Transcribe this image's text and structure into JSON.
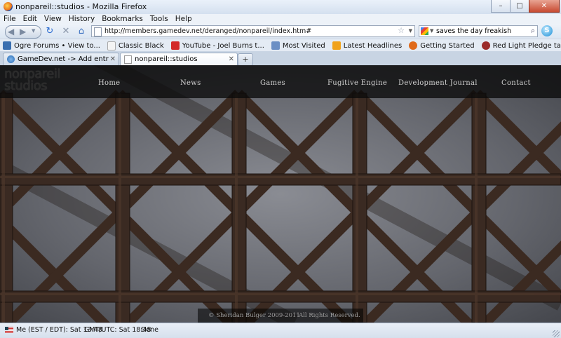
{
  "window": {
    "title": "nonpareil::studios - Mozilla Firefox"
  },
  "menu": [
    "File",
    "Edit",
    "View",
    "History",
    "Bookmarks",
    "Tools",
    "Help"
  ],
  "navigation": {
    "url": "http://members.gamedev.net/deranged/nonpareil/index.htm#",
    "search_value": "saves the day freakish"
  },
  "bookmarks": [
    {
      "label": "Ogre Forums • View to...",
      "color": "#3a6fb0"
    },
    {
      "label": "Classic Black",
      "color": "#d8d8d8"
    },
    {
      "label": "YouTube - Joel Burns t...",
      "color": "#d32a2a"
    },
    {
      "label": "Most Visited",
      "color": "#6b8fc4"
    },
    {
      "label": "Latest Headlines",
      "color": "#f0a21c"
    },
    {
      "label": "Getting Started",
      "color": "#e06a1a"
    },
    {
      "label": "Red Light Pledge tab b...",
      "color": "#9b2b2b"
    }
  ],
  "tabs": [
    {
      "label": "GameDev.net -> Add entry The Fug...",
      "active": false
    },
    {
      "label": "nonpareil::studios",
      "active": true
    }
  ],
  "site": {
    "logo_line1": "nonpareil",
    "logo_line2": "studios",
    "nav": [
      "Home",
      "News",
      "Games",
      "Fugitive Engine",
      "Development Journal",
      "Contact"
    ],
    "footer_copyright": "© Sheridan Bulger 2009-2011",
    "footer_rights": "All Rights Reserved."
  },
  "status": {
    "local_time": "Me (EST / EDT): Sat 13:48",
    "utc_time": "GMT/UTC: Sat 18:48",
    "state": "Done"
  },
  "colors": {
    "wood": "#3e2a22",
    "stone": "#6f7178",
    "nav_bg": "#0a0a0a"
  }
}
